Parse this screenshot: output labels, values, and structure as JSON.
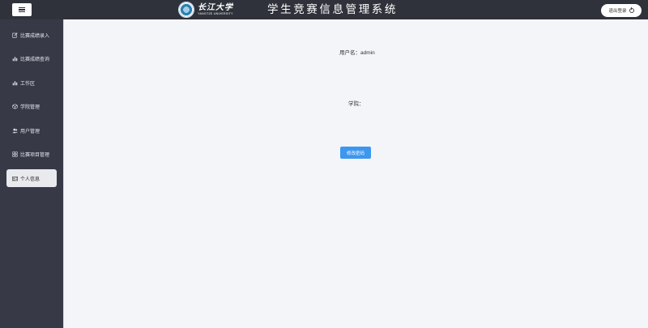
{
  "header": {
    "logo_cn": "长江大学",
    "logo_en": "YANGTZE UNIVERSITY",
    "system_title": "学生竞赛信息管理系统",
    "logout_label": "退出登录"
  },
  "sidebar": {
    "items": [
      {
        "label": "比赛成绩录入",
        "icon": "edit-icon"
      },
      {
        "label": "比赛成绩查询",
        "icon": "bar-chart-icon"
      },
      {
        "label": "工作区",
        "icon": "bar-chart-icon"
      },
      {
        "label": "学院管理",
        "icon": "cube-icon"
      },
      {
        "label": "用户管理",
        "icon": "users-icon"
      },
      {
        "label": "比赛项目管理",
        "icon": "grid-icon"
      },
      {
        "label": "个人信息",
        "icon": "id-card-icon",
        "active": true
      }
    ]
  },
  "profile": {
    "username_label": "用户名：",
    "username_value": "admin",
    "college_label": "学院：",
    "college_value": "",
    "edit_password_label": "修改密码"
  }
}
